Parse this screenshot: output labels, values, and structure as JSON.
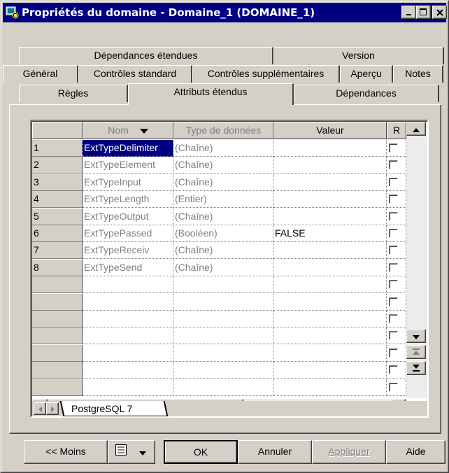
{
  "window": {
    "title": "Propriétés du domaine - Domaine_1 (DOMAINE_1)"
  },
  "tabs": {
    "row1": [
      "Dépendances étendues",
      "Version"
    ],
    "row2": [
      "Général",
      "Contrôles standard",
      "Contrôles supplémentaires",
      "Aperçu",
      "Notes"
    ],
    "row3": [
      "Règles",
      "Attributs étendus",
      "Dépendances"
    ],
    "selected": "Attributs étendus"
  },
  "grid": {
    "columns": [
      "Nom",
      "Type de données",
      "Valeur",
      "R"
    ],
    "rows": [
      {
        "num": "1",
        "nom": "ExtTypeDelimiter",
        "type": "(Chaîne)",
        "valeur": ""
      },
      {
        "num": "2",
        "nom": "ExtTypeElement",
        "type": "(Chaîne)",
        "valeur": ""
      },
      {
        "num": "3",
        "nom": "ExtTypeInput",
        "type": "(Chaîne)",
        "valeur": ""
      },
      {
        "num": "4",
        "nom": "ExtTypeLength",
        "type": "(Entier)",
        "valeur": ""
      },
      {
        "num": "5",
        "nom": "ExtTypeOutput",
        "type": "(Chaîne)",
        "valeur": ""
      },
      {
        "num": "6",
        "nom": "ExtTypePassed",
        "type": "(Booléen)",
        "valeur": "FALSE"
      },
      {
        "num": "7",
        "nom": "ExtTypeReceiv",
        "type": "(Chaîne)",
        "valeur": ""
      },
      {
        "num": "8",
        "nom": "ExtTypeSend",
        "type": "(Chaîne)",
        "valeur": ""
      }
    ],
    "sheet_tab": "PostgreSQL 7"
  },
  "buttons": {
    "less": "<< Moins",
    "ok": "OK",
    "cancel": "Annuler",
    "apply": "Appliquer",
    "help": "Aide"
  },
  "colors": {
    "title_bg": "#000080",
    "face": "#d4d0c8",
    "selection": "#000080"
  }
}
